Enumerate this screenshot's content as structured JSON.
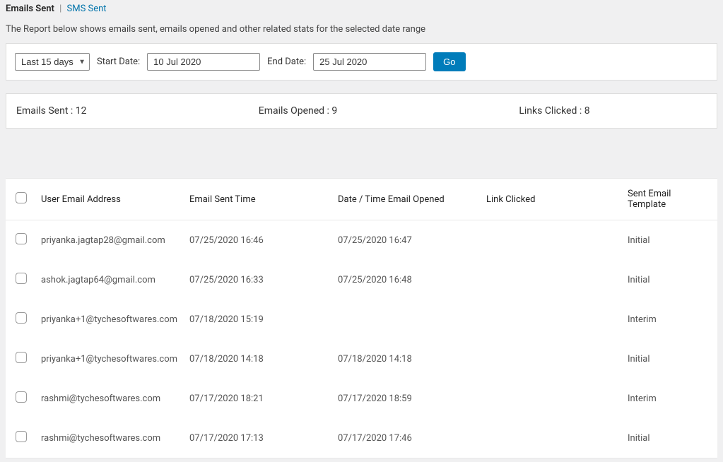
{
  "tabs": {
    "emails": "Emails Sent",
    "sms": "SMS Sent"
  },
  "subtext": "The Report below shows emails sent, emails opened and other related stats for the selected date range",
  "controls": {
    "range_label": "Last 15 days",
    "start_label": "Start Date:",
    "start_value": "10 Jul 2020",
    "end_label": "End Date:",
    "end_value": "25 Jul 2020",
    "go_label": "Go"
  },
  "stats": {
    "sent_label": "Emails Sent : ",
    "sent_value": "12",
    "opened_label": "Emails Opened : ",
    "opened_value": "9",
    "clicked_label": "Links Clicked : ",
    "clicked_value": "8"
  },
  "columns": {
    "email": "User Email Address",
    "sent_time": "Email Sent Time",
    "opened_time": "Date / Time Email Opened",
    "link": "Link Clicked",
    "template": "Sent Email Template"
  },
  "rows": [
    {
      "email": "priyanka.jagtap28@gmail.com",
      "sent": "07/25/2020 16:46",
      "opened": "07/25/2020 16:47",
      "link": "",
      "template": "Initial"
    },
    {
      "email": "ashok.jagtap64@gmail.com",
      "sent": "07/25/2020 16:33",
      "opened": "07/25/2020 16:48",
      "link": "",
      "template": "Initial"
    },
    {
      "email": "priyanka+1@tychesoftwares.com",
      "sent": "07/18/2020 15:19",
      "opened": "",
      "link": "",
      "template": "Interim"
    },
    {
      "email": "priyanka+1@tychesoftwares.com",
      "sent": "07/18/2020 14:18",
      "opened": "07/18/2020 14:18",
      "link": "",
      "template": "Initial"
    },
    {
      "email": "rashmi@tychesoftwares.com",
      "sent": "07/17/2020 18:21",
      "opened": "07/17/2020 18:59",
      "link": "",
      "template": "Interim"
    },
    {
      "email": "rashmi@tychesoftwares.com",
      "sent": "07/17/2020 17:13",
      "opened": "07/17/2020 17:46",
      "link": "",
      "template": "Initial"
    }
  ]
}
